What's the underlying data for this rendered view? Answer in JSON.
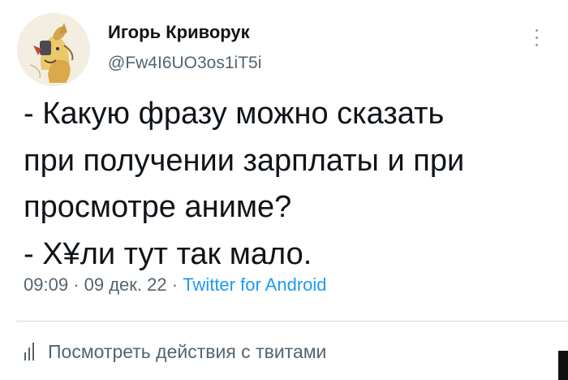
{
  "author": {
    "name": "Игорь Криворук",
    "handle": "@Fw4I6UO3os1iT5i"
  },
  "tweet": {
    "text": "- Какую фразу можно сказать\nпри получении зарплаты и при\nпросмотре аниме?\n- Х¥ли тут так мало.",
    "time": "09:09",
    "separator": "·",
    "date": "09 дек. 22",
    "source": "Twitter for Android"
  },
  "analytics": {
    "label": "Посмотреть действия с твитами",
    "icon": "bar-chart-icon"
  },
  "icons": {
    "more": "more-vertical-icon"
  },
  "colors": {
    "text_primary": "#0f1419",
    "text_secondary": "#536471",
    "link": "#1d9bf0",
    "divider": "#d9dde0"
  }
}
